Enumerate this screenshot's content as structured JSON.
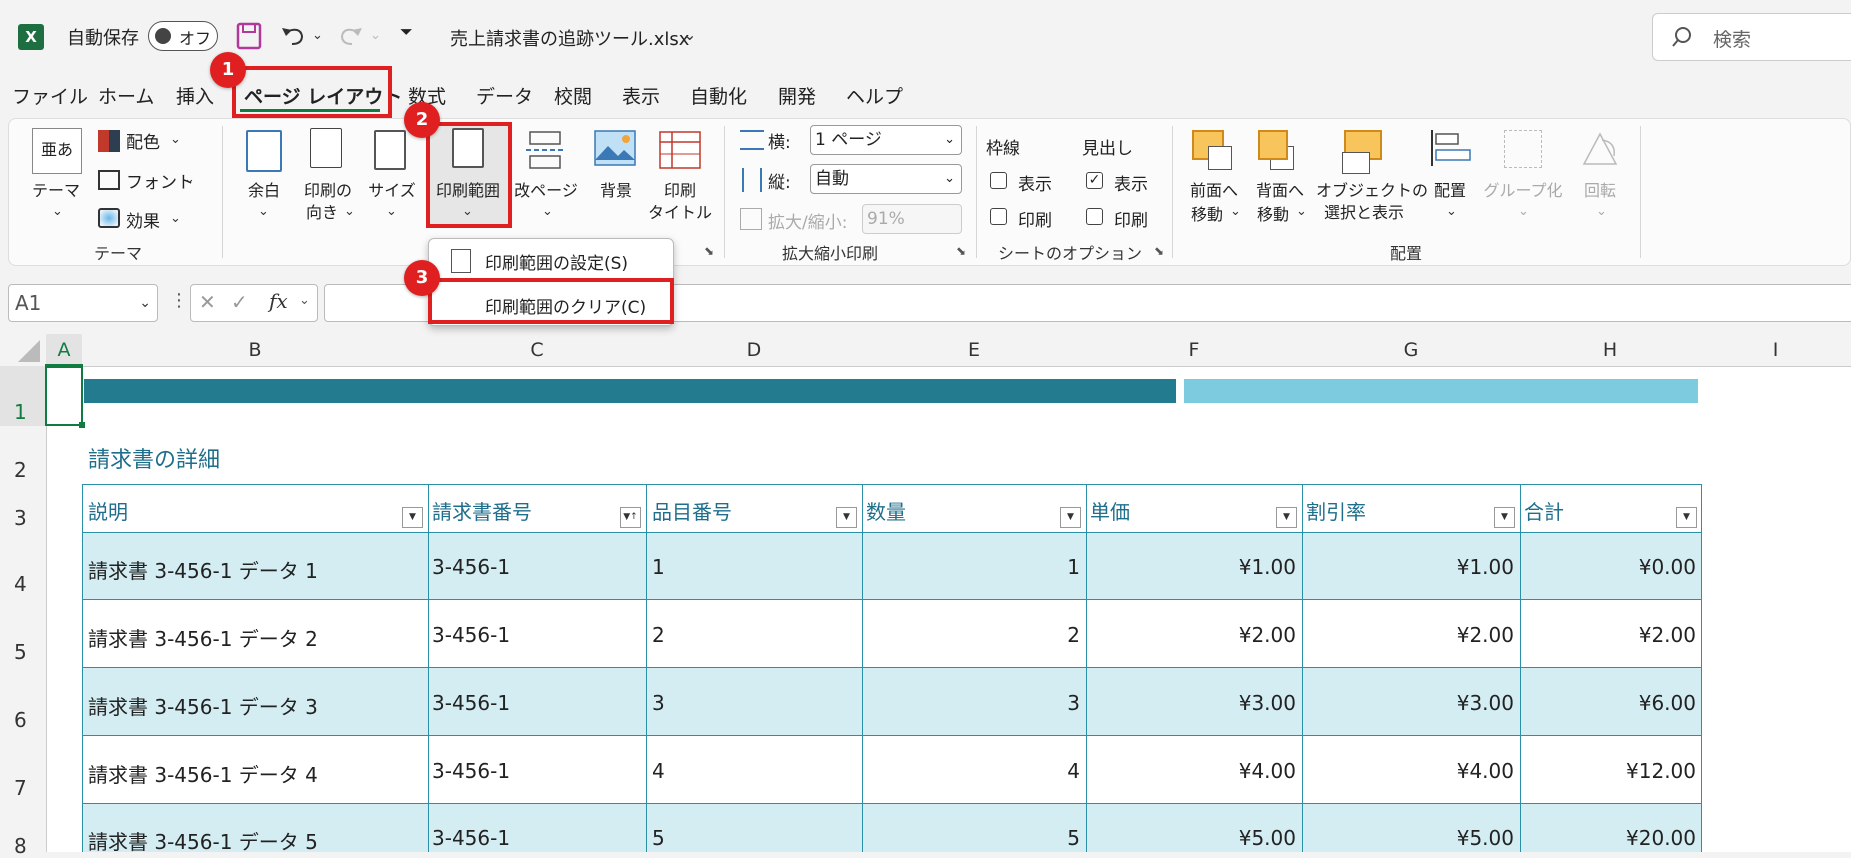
{
  "titlebar": {
    "app_icon": "X",
    "autosave_label": "自動保存",
    "autosave_state": "オフ",
    "filename": "売上請求書の追跡ツール.xlsx",
    "search_placeholder": "検索"
  },
  "menu_tabs": [
    "ファイル",
    "ホーム",
    "挿入",
    "ページ レイアウト",
    "数式",
    "データ",
    "校閲",
    "表示",
    "自動化",
    "開発",
    "ヘルプ"
  ],
  "ribbon": {
    "theme_group": {
      "theme": "テーマ",
      "colors": "配色",
      "fonts": "フォント",
      "effects": "効果",
      "group_label": "テーマ"
    },
    "page_setup": {
      "margins": "余白",
      "orientation_1": "印刷の",
      "orientation_2": "向き",
      "size": "サイズ",
      "print_area": "印刷範囲",
      "breaks": "改ページ",
      "background": "背景",
      "print_titles_1": "印刷",
      "print_titles_2": "タイトル"
    },
    "scale": {
      "width_label": "横:",
      "width_value": "1 ページ",
      "height_label": "縦:",
      "height_value": "自動",
      "scale_label": "拡大/縮小:",
      "scale_value": "91%",
      "group_label": "拡大縮小印刷"
    },
    "sheet_options": {
      "gridlines": "枠線",
      "headings": "見出し",
      "view": "表示",
      "print": "印刷",
      "group_label": "シートのオプション"
    },
    "arrange": {
      "bring_forward_1": "前面へ",
      "bring_forward_2": "移動",
      "send_backward_1": "背面へ",
      "send_backward_2": "移動",
      "selection_pane_1": "オブジェクトの",
      "selection_pane_2": "選択と表示",
      "align": "配置",
      "group": "グループ化",
      "rotate": "回転",
      "group_label": "配置"
    }
  },
  "dropdown": {
    "set_print_area": "印刷範囲の設定(S)",
    "clear_print_area": "印刷範囲のクリア(C)"
  },
  "badges": [
    "1",
    "2",
    "3"
  ],
  "formula_bar": {
    "name_box": "A1",
    "fx": "fx",
    "cancel": "✕",
    "enter": "✓"
  },
  "columns": [
    "A",
    "B",
    "C",
    "D",
    "E",
    "F",
    "G",
    "H",
    "I"
  ],
  "rows": [
    "1",
    "2",
    "3",
    "4",
    "5",
    "6",
    "7",
    "8"
  ],
  "sheet": {
    "section_title": "請求書の詳細",
    "headers": [
      "説明",
      "請求書番号",
      "品目番号",
      "数量",
      "単価",
      "割引率",
      "合計"
    ],
    "data": [
      [
        "請求書 3-456-1 データ 1",
        "3-456-1",
        "1",
        "1",
        "¥1.00",
        "¥1.00",
        "¥0.00"
      ],
      [
        "請求書 3-456-1 データ 2",
        "3-456-1",
        "2",
        "2",
        "¥2.00",
        "¥2.00",
        "¥2.00"
      ],
      [
        "請求書 3-456-1 データ 3",
        "3-456-1",
        "3",
        "3",
        "¥3.00",
        "¥3.00",
        "¥6.00"
      ],
      [
        "請求書 3-456-1 データ 4",
        "3-456-1",
        "4",
        "4",
        "¥4.00",
        "¥4.00",
        "¥12.00"
      ],
      [
        "請求書 3-456-1 データ 5",
        "3-456-1",
        "5",
        "5",
        "¥5.00",
        "¥5.00",
        "¥20.00"
      ]
    ]
  },
  "colors": {
    "accent_dark": "#237b8f",
    "accent_light": "#7ccbde",
    "band": "#d3edf3",
    "annotation": "#e02020"
  }
}
